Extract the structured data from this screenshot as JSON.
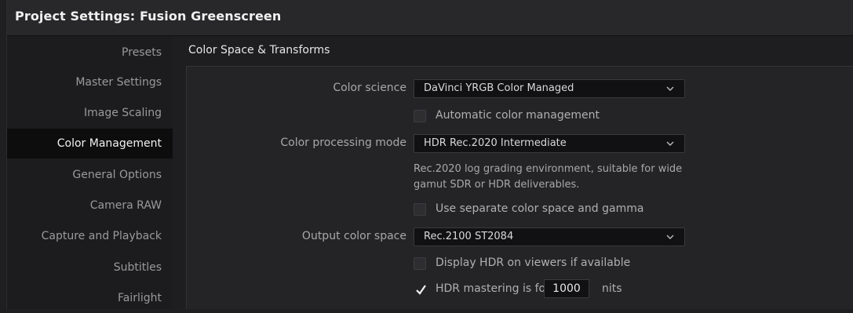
{
  "window": {
    "title": "Project Settings:  Fusion Greenscreen"
  },
  "sidebar": {
    "items": [
      {
        "label": "Presets",
        "active": false
      },
      {
        "label": "Master Settings",
        "active": false
      },
      {
        "label": "Image Scaling",
        "active": false
      },
      {
        "label": "Color Management",
        "active": true
      },
      {
        "label": "General Options",
        "active": false
      },
      {
        "label": "Camera RAW",
        "active": false
      },
      {
        "label": "Capture and Playback",
        "active": false
      },
      {
        "label": "Subtitles",
        "active": false
      },
      {
        "label": "Fairlight",
        "active": false
      }
    ]
  },
  "section": {
    "title": "Color Space & Transforms"
  },
  "form": {
    "color_science": {
      "label": "Color science",
      "value": "DaVinci YRGB Color Managed"
    },
    "auto_color_mgmt": {
      "label": "Automatic color management",
      "checked": false
    },
    "color_processing_mode": {
      "label": "Color processing mode",
      "value": "HDR Rec.2020 Intermediate"
    },
    "processing_note": "Rec.2020 log grading environment, suitable for wide gamut SDR or HDR deliverables.",
    "separate_color_space": {
      "label": "Use separate color space and gamma",
      "checked": false
    },
    "output_color_space": {
      "label": "Output color space",
      "value": "Rec.2100 ST2084"
    },
    "display_hdr": {
      "label": "Display HDR on viewers if available",
      "checked": false
    },
    "hdr_mastering": {
      "label": "HDR mastering is for",
      "checked": true,
      "value": "1000",
      "unit": "nits"
    }
  },
  "icons": {
    "dropdown": "chevron-down-icon",
    "checkmark": "checkmark-icon"
  },
  "colors": {
    "active_nav_bg": "#0d0d0e",
    "panel_bg": "#242426",
    "titlebar_bg": "#28282a"
  }
}
